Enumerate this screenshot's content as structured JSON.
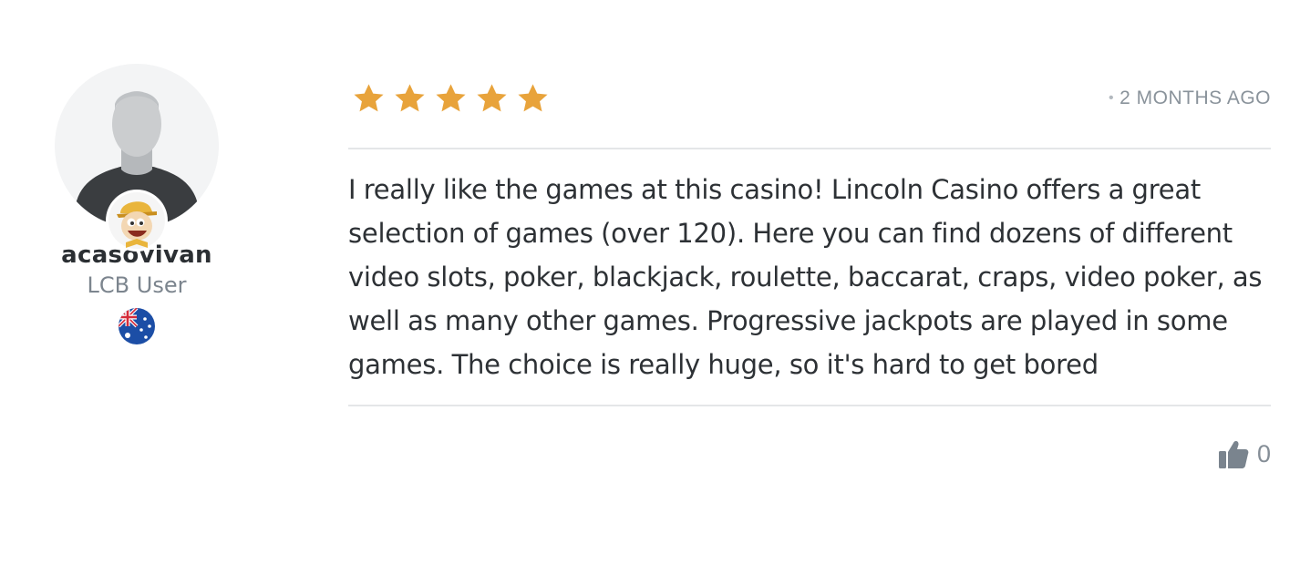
{
  "author": {
    "username": "acasovivan",
    "role": "LCB User",
    "avatar_icon": "default-user-silhouette",
    "badge_icon": "lcb-mascot-badge",
    "country_flag_icon": "australia-flag-icon"
  },
  "review": {
    "rating": 5,
    "max_rating": 5,
    "star_color": "#e8a33b",
    "date": "2 MONTHS AGO",
    "body": "I really like the games at this casino! Lincoln Casino offers a great selection of games (over 120). Here you can find dozens of different video slots, poker, blackjack, roulette, baccarat, craps, video poker, as well as many other games. Progressive jackpots are played in some games. The choice is really huge, so it's hard to get bored",
    "likes": "0",
    "like_icon": "thumbs-up-icon"
  }
}
